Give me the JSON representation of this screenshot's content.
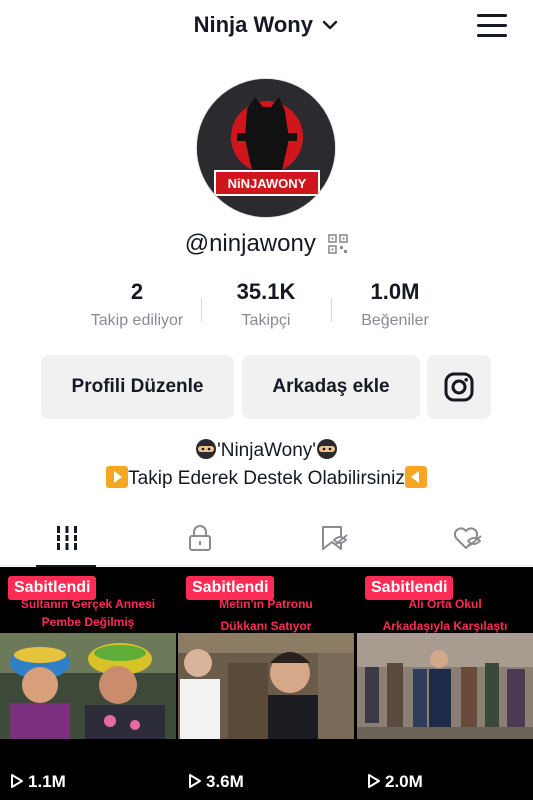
{
  "header": {
    "title": "Ninja Wony",
    "menu_icon": "hamburger-menu-icon"
  },
  "profile": {
    "avatar_text": "NiNJAWONY",
    "username": "@ninjawony",
    "qr_icon": "qr-code-icon"
  },
  "stats": [
    {
      "value": "2",
      "label": "Takip ediliyor"
    },
    {
      "value": "35.1K",
      "label": "Takipçi"
    },
    {
      "value": "1.0M",
      "label": "Beğeniler"
    }
  ],
  "buttons": {
    "edit_label": "Profili Düzenle",
    "add_label": "Arkadaş ekle",
    "instagram_icon": "instagram-icon"
  },
  "bio": {
    "line1": "'NinjaWony'",
    "line2": "Takip Ederek Destek Olabilirsiniz"
  },
  "tabs": [
    {
      "icon": "videos-grid-icon",
      "active": true
    },
    {
      "icon": "lock-icon",
      "active": false
    },
    {
      "icon": "bookmark-icon",
      "active": false
    },
    {
      "icon": "liked-heart-icon",
      "active": false
    }
  ],
  "videos": [
    {
      "pinned_label": "Sabitlendi",
      "caption1": "Sultanın Gerçek Annesi",
      "caption2": "Pembe Değilmiş",
      "views": "1.1M"
    },
    {
      "pinned_label": "Sabitlendi",
      "caption1": "Metin'in Patronu",
      "caption2": "Dükkanı Satıyor",
      "views": "3.6M"
    },
    {
      "pinned_label": "Sabitlendi",
      "caption1": "Ali Orta Okul",
      "caption2": "Arkadaşıyla Karşılaştı",
      "views": "2.0M"
    }
  ],
  "colors": {
    "accent": "#fe2c55",
    "text": "#161823",
    "muted": "#8a8b91",
    "button_bg": "#f1f1f2"
  }
}
